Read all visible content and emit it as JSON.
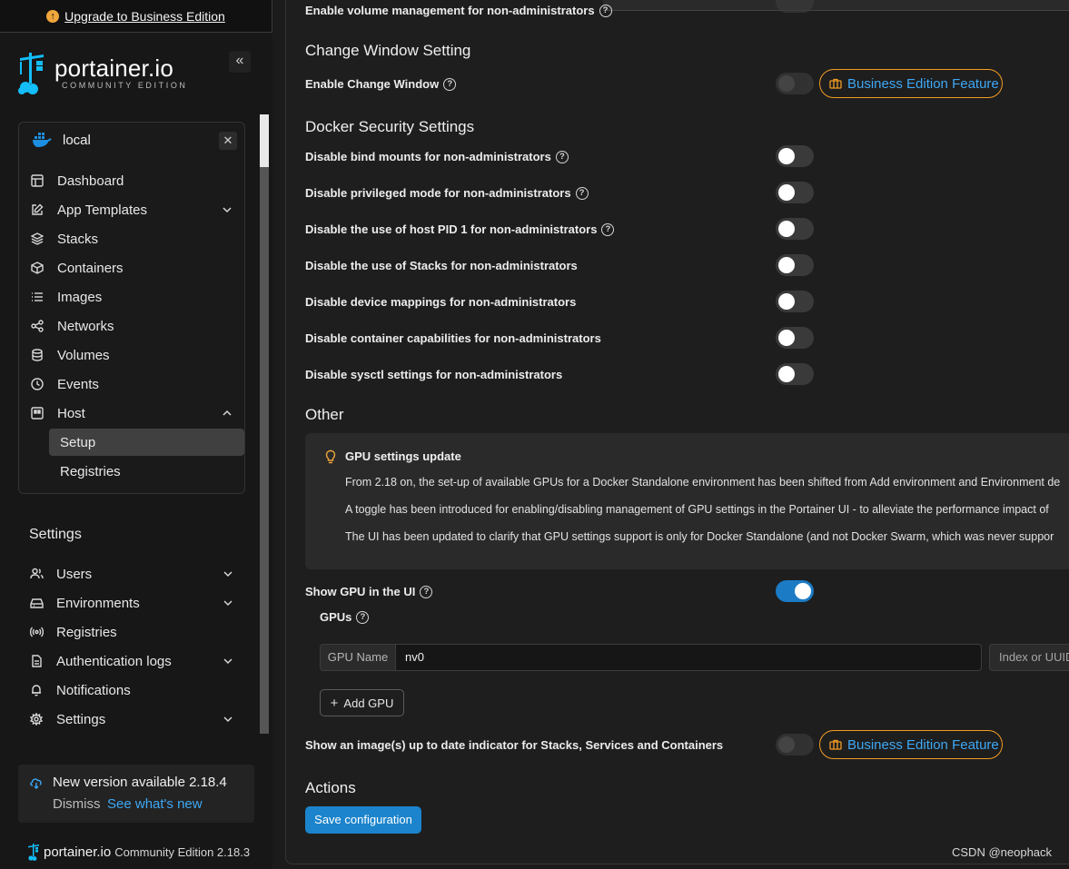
{
  "upgrade": {
    "label": "Upgrade to Business Edition"
  },
  "logo": {
    "name": "portainer.io",
    "edition": "COMMUNITY EDITION"
  },
  "environment": {
    "name": "local"
  },
  "nav": {
    "items": [
      {
        "label": "Dashboard",
        "icon": "dashboard-icon"
      },
      {
        "label": "App Templates",
        "icon": "edit-icon",
        "expandable": true
      },
      {
        "label": "Stacks",
        "icon": "layers-icon"
      },
      {
        "label": "Containers",
        "icon": "box-icon"
      },
      {
        "label": "Images",
        "icon": "list-icon"
      },
      {
        "label": "Networks",
        "icon": "share-icon"
      },
      {
        "label": "Volumes",
        "icon": "database-icon"
      },
      {
        "label": "Events",
        "icon": "clock-icon"
      },
      {
        "label": "Host",
        "icon": "host-icon",
        "expanded": true
      }
    ],
    "host_sub": [
      "Setup",
      "Registries"
    ]
  },
  "settings_nav": {
    "title": "Settings",
    "items": [
      {
        "label": "Users",
        "icon": "users-icon"
      },
      {
        "label": "Environments",
        "icon": "hdd-icon"
      },
      {
        "label": "Registries",
        "icon": "radio-icon"
      },
      {
        "label": "Authentication logs",
        "icon": "file-icon"
      },
      {
        "label": "Notifications",
        "icon": "bell-icon"
      },
      {
        "label": "Settings",
        "icon": "gear-icon"
      }
    ]
  },
  "update": {
    "message": "New version available 2.18.4",
    "dismiss": "Dismiss",
    "whats_new": "See what's new"
  },
  "footer": {
    "name": "portainer.io",
    "edition": "Community Edition 2.18.3"
  },
  "main": {
    "partial_top_label": "Enable volume management for non-administrators",
    "change_window": {
      "title": "Change Window Setting",
      "label": "Enable Change Window",
      "badge": "Business Edition Feature"
    },
    "security": {
      "title": "Docker Security Settings",
      "rows": [
        {
          "label": "Disable bind mounts for non-administrators",
          "help": true
        },
        {
          "label": "Disable privileged mode for non-administrators",
          "help": true
        },
        {
          "label": "Disable the use of host PID 1 for non-administrators",
          "help": true
        },
        {
          "label": "Disable the use of Stacks for non-administrators",
          "help": false
        },
        {
          "label": "Disable device mappings for non-administrators",
          "help": false
        },
        {
          "label": "Disable container capabilities for non-administrators",
          "help": false
        },
        {
          "label": "Disable sysctl settings for non-administrators",
          "help": false
        }
      ]
    },
    "other": {
      "title": "Other",
      "info_title": "GPU settings update",
      "info_lines": [
        "From 2.18 on, the set-up of available GPUs for a Docker Standalone environment has been shifted from Add environment and Environment de",
        "A toggle has been introduced for enabling/disabling management of GPU settings in the Portainer UI - to alleviate the performance impact of",
        "The UI has been updated to clarify that GPU settings support is only for Docker Standalone (and not Docker Swarm, which was never suppor"
      ],
      "show_gpu_label": "Show GPU in the UI",
      "show_gpu_on": true,
      "gpus_label": "GPUs",
      "gpu_name_addon": "GPU Name",
      "gpu_name_value": "nv0",
      "gpu_index_placeholder": "Index or UUID",
      "add_gpu": "Add GPU",
      "image_indicator_label": "Show an image(s) up to date indicator for Stacks, Services and Containers",
      "image_indicator_badge": "Business Edition Feature"
    },
    "actions": {
      "title": "Actions",
      "save": "Save configuration"
    }
  },
  "watermark": "CSDN @neophack",
  "colors": {
    "accent": "#1b84cc",
    "badge_border": "#f39c25",
    "link": "#3ea8f5"
  }
}
